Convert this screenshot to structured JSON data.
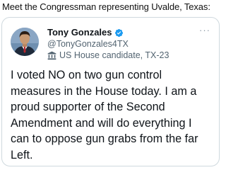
{
  "headline": "Meet the Congressman representing Uvalde, Texas:",
  "tweet": {
    "display_name": "Tony Gonzales",
    "verified": true,
    "handle": "@TonyGonzales4TX",
    "label": "US House candidate, TX-23",
    "label_icon": "government-building-icon",
    "more_icon": "more-options-icon",
    "more_text": "···",
    "text": "I voted NO on two gun control\nmeasures in the House today. I am a\nproud supporter of the Second\nAmendment and will do everything I\ncan to oppose gun grabs from the far\nLeft."
  },
  "colors": {
    "verified_badge": "#1d9bf0",
    "secondary_text": "#536471",
    "primary_text": "#0f1419",
    "border": "#cfd9de"
  }
}
